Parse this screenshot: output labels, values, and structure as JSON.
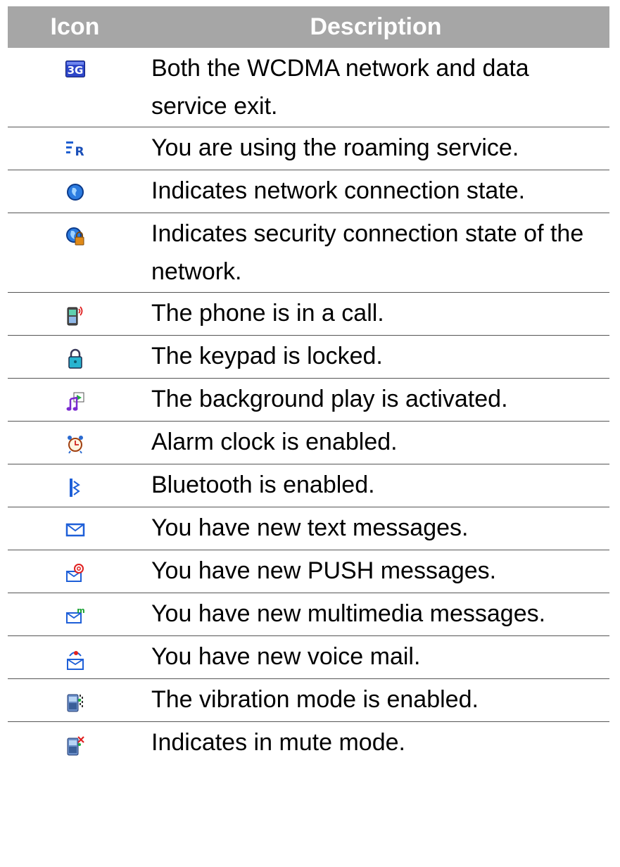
{
  "table": {
    "header": {
      "icon": "Icon",
      "description": "Description"
    },
    "rows": [
      {
        "icon": "3g-icon",
        "description": "Both the WCDMA network and data service exit."
      },
      {
        "icon": "roaming-icon",
        "description": "You are using the roaming service."
      },
      {
        "icon": "globe-icon",
        "description": "Indicates network connection state."
      },
      {
        "icon": "secure-globe-icon",
        "description": "Indicates security connection state of the network."
      },
      {
        "icon": "phone-call-icon",
        "description": "The phone is in a call."
      },
      {
        "icon": "keypad-lock-icon",
        "description": "The keypad is locked."
      },
      {
        "icon": "background-play-icon",
        "description": "The background play is activated."
      },
      {
        "icon": "alarm-clock-icon",
        "description": "Alarm clock is enabled."
      },
      {
        "icon": "bluetooth-icon",
        "description": "Bluetooth is enabled."
      },
      {
        "icon": "text-message-icon",
        "description": "You have new text messages."
      },
      {
        "icon": "push-message-icon",
        "description": "You have new PUSH messages."
      },
      {
        "icon": "multimedia-message-icon",
        "description": "You have new multimedia messages."
      },
      {
        "icon": "voice-mail-icon",
        "description": "You have new voice mail."
      },
      {
        "icon": "vibration-mode-icon",
        "description": "The vibration mode is enabled."
      },
      {
        "icon": "mute-mode-icon",
        "description": "Indicates in mute mode."
      }
    ]
  }
}
